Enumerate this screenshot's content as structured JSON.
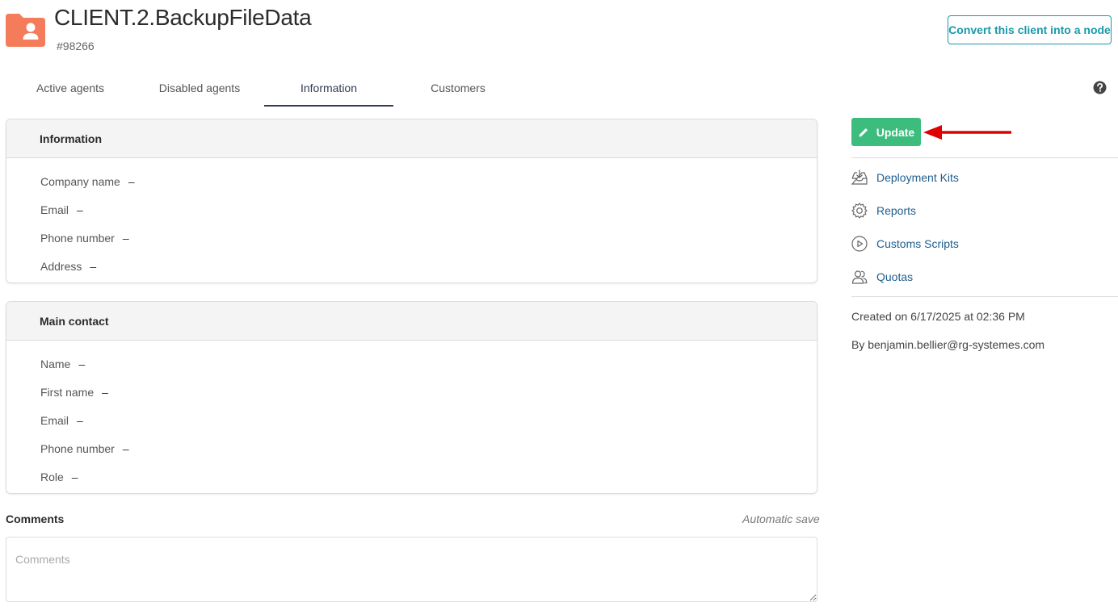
{
  "header": {
    "title": "CLIENT.2.BackupFileData",
    "id": "#98266",
    "icon": "client-folder-icon",
    "icon_color": "#f47c5a",
    "convert_label": "Convert this client into a node"
  },
  "tabs": [
    {
      "label": "Active agents",
      "active": false
    },
    {
      "label": "Disabled agents",
      "active": false
    },
    {
      "label": "Information",
      "active": true
    },
    {
      "label": "Customers",
      "active": false
    }
  ],
  "information": {
    "title": "Information",
    "fields": [
      {
        "label": "Company name",
        "value": "–"
      },
      {
        "label": "Email",
        "value": "–"
      },
      {
        "label": "Phone number",
        "value": "–"
      },
      {
        "label": "Address",
        "value": "–"
      }
    ]
  },
  "main_contact": {
    "title": "Main contact",
    "fields": [
      {
        "label": "Name",
        "value": "–"
      },
      {
        "label": "First name",
        "value": "–"
      },
      {
        "label": "Email",
        "value": "–"
      },
      {
        "label": "Phone number",
        "value": "–"
      },
      {
        "label": "Role",
        "value": "–"
      }
    ]
  },
  "comments": {
    "label": "Comments",
    "autosave": "Automatic save",
    "placeholder": "Comments"
  },
  "sidebar": {
    "update_label": "Update",
    "links": [
      {
        "label": "Deployment Kits",
        "icon": "inbox-download-icon"
      },
      {
        "label": "Reports",
        "icon": "gear-icon"
      },
      {
        "label": "Customs Scripts",
        "icon": "play-circle-icon"
      },
      {
        "label": "Quotas",
        "icon": "users-icon"
      }
    ],
    "created": "Created on 6/17/2025 at 02:36 PM",
    "by": "By benjamin.bellier@rg-systemes.com"
  },
  "colors": {
    "accent": "#1a9aab",
    "update_green": "#3dbd7d",
    "link_blue": "#1f5e8f",
    "annotation_red": "#e00000"
  }
}
